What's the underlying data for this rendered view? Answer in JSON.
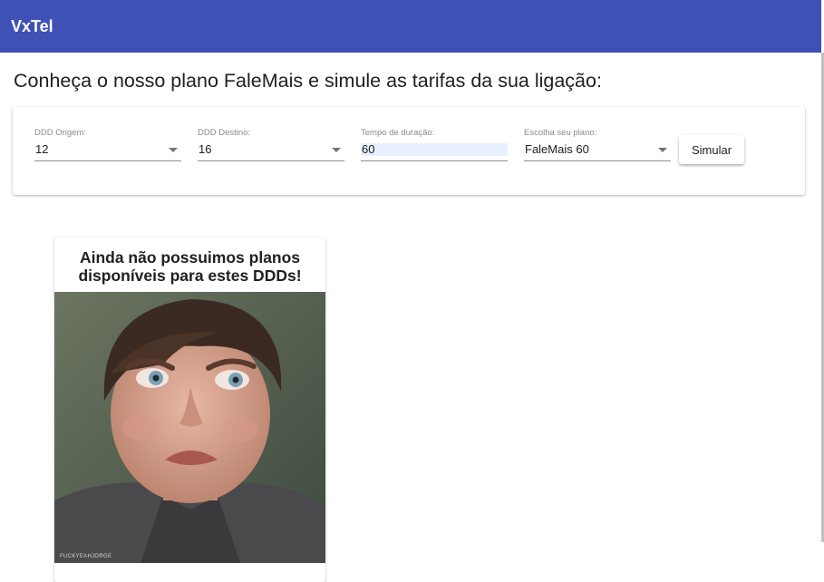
{
  "app": {
    "title": "VxTel"
  },
  "headline": "Conheça o nosso plano FaleMais e simule as tarifas da sua ligação:",
  "form": {
    "ddd_origem": {
      "label": "DDD Origem:",
      "value": "12"
    },
    "ddd_destino": {
      "label": "DDD Destino:",
      "value": "16"
    },
    "tempo": {
      "label": "Tempo de duração:",
      "value": "60"
    },
    "plano": {
      "label": "Escolha seu plano:",
      "value": "FaleMais 60"
    },
    "submit_label": "Simular"
  },
  "result": {
    "title_line1": "Ainda não possuimos planos",
    "title_line2": "disponíveis para estes DDDs!",
    "image_credit": "FUCKYEAHJORGE",
    "icons": {
      "select_caret": "chevron-down-icon"
    }
  }
}
